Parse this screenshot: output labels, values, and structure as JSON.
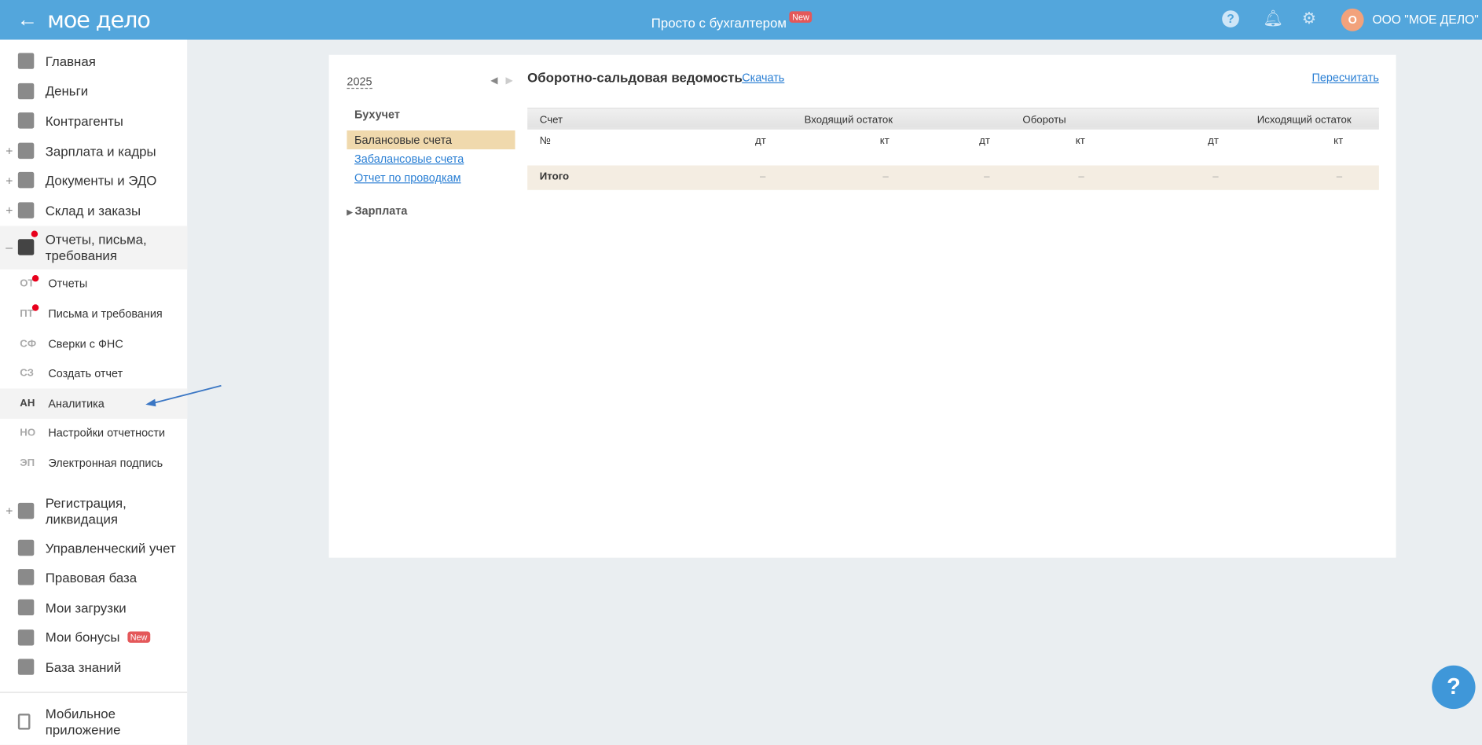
{
  "header": {
    "logo": "мое дело",
    "center_label": "Просто с бухгалтером",
    "new_badge": "New",
    "avatar_letter": "О",
    "org_name": "ООО \"МОЕ ДЕЛО\""
  },
  "sidebar": {
    "items": [
      {
        "label": "Главная"
      },
      {
        "label": "Деньги"
      },
      {
        "label": "Контрагенты"
      },
      {
        "label": "Зарплата и кадры",
        "plus": "+"
      },
      {
        "label": "Документы и ЭДО",
        "plus": "+"
      },
      {
        "label": "Склад и заказы",
        "plus": "+"
      },
      {
        "label": "Отчеты, письма, требования",
        "plus": "–"
      }
    ],
    "subitems": [
      {
        "abbr": "ОТ",
        "label": "Отчеты"
      },
      {
        "abbr": "ПТ",
        "label": "Письма и требования"
      },
      {
        "abbr": "СФ",
        "label": "Сверки с ФНС"
      },
      {
        "abbr": "СЗ",
        "label": "Создать отчет"
      },
      {
        "abbr": "АН",
        "label": "Аналитика"
      },
      {
        "abbr": "НО",
        "label": "Настройки отчетности"
      },
      {
        "abbr": "ЭП",
        "label": "Электронная подпись"
      }
    ],
    "items2": [
      {
        "label": "Регистрация, ликвидация",
        "plus": "+"
      },
      {
        "label": "Управленческий учет"
      },
      {
        "label": "Правовая база"
      },
      {
        "label": "Мои загрузки"
      },
      {
        "label": "Мои бонусы",
        "badge": "New"
      },
      {
        "label": "База знаний"
      }
    ],
    "mobile": "Мобильное приложение"
  },
  "panel": {
    "year": "2025",
    "nav_heading": "Бухучет",
    "nav": [
      "Балансовые счета",
      "Забалансовые счета",
      "Отчет по проводкам"
    ],
    "salary": "Зарплата",
    "title": "Оборотно-сальдовая ведомость",
    "download": "Скачать",
    "recalc": "Пересчитать",
    "table": {
      "h_account": "Счет",
      "h_in": "Входящий остаток",
      "h_turn": "Обороты",
      "h_out": "Исходящий остаток",
      "num": "№",
      "dt": "дт",
      "kt": "кт",
      "total": "Итого",
      "dash": "–"
    }
  },
  "help": "?"
}
